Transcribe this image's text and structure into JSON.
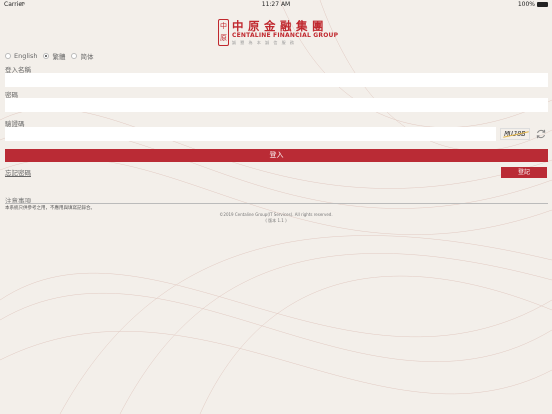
{
  "status_bar": {
    "carrier": "Carrier",
    "time": "11:27 AM",
    "battery": "100%"
  },
  "logo": {
    "seal_chars": [
      "中",
      "原"
    ],
    "name_zh": "中原金融集團",
    "name_en": "CENTALINE FINANCIAL GROUP",
    "tagline": "誠 懇 為 本    誠 信 服 務"
  },
  "language": {
    "options": [
      {
        "label": "English",
        "checked": false
      },
      {
        "label": "繁體",
        "checked": true
      },
      {
        "label": "简体",
        "checked": false
      }
    ]
  },
  "form": {
    "username_label": "登入名稱",
    "username_value": "",
    "password_label": "密碼",
    "password_value": "",
    "captcha_label": "驗證碼",
    "captcha_value": "",
    "captcha_image_text": "MUJ8B",
    "login_button": "登入",
    "forgot_link": "忘記密碼",
    "register_button": "登記"
  },
  "notice": {
    "title": "注意事項",
    "text": "本系統只供參考之用，不應用與填寫記錄合。"
  },
  "footer": {
    "copyright": "©2019 Centaline Group(IT Services). All rights reserved.",
    "version": "( 版本 1.1 )"
  },
  "colors": {
    "accent": "#ba2b35",
    "background": "#f3efea"
  }
}
